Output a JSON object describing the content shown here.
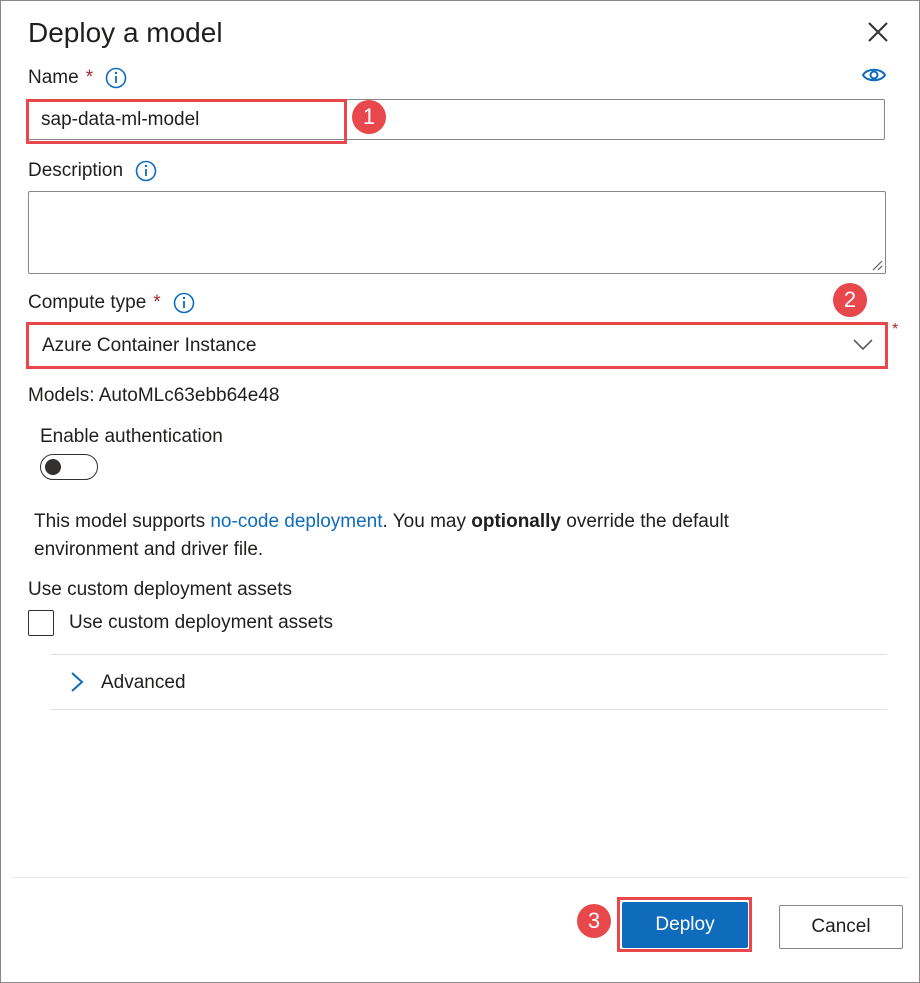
{
  "dialog": {
    "title": "Deploy a model",
    "close_icon": "close-icon"
  },
  "name_field": {
    "label": "Name",
    "required_mark": "*",
    "value": "sap-data-ml-model",
    "info_icon": "info-icon",
    "visibility_icon": "eye-icon"
  },
  "description_field": {
    "label": "Description",
    "value": ""
  },
  "compute_type": {
    "label": "Compute type",
    "required_mark": "*",
    "selected": "Azure Container Instance",
    "side_required_mark": "*"
  },
  "models_text": "Models: AutoMLc63ebb64e48",
  "authentication": {
    "label": "Enable authentication",
    "enabled": false
  },
  "support_text": {
    "prefix": "This model supports ",
    "link": "no-code deployment",
    "middle": ". You may ",
    "bold": "optionally",
    "suffix": " override the default environment and driver file."
  },
  "custom_assets": {
    "section_label": "Use custom deployment assets",
    "checkbox_label": "Use custom deployment assets",
    "checked": false
  },
  "advanced": {
    "label": "Advanced"
  },
  "markers": [
    "1",
    "2",
    "3"
  ],
  "buttons": {
    "deploy": "Deploy",
    "cancel": "Cancel"
  },
  "colors": {
    "primary": "#0f6cbd",
    "highlight": "#e8474b",
    "required": "#a4262c"
  }
}
